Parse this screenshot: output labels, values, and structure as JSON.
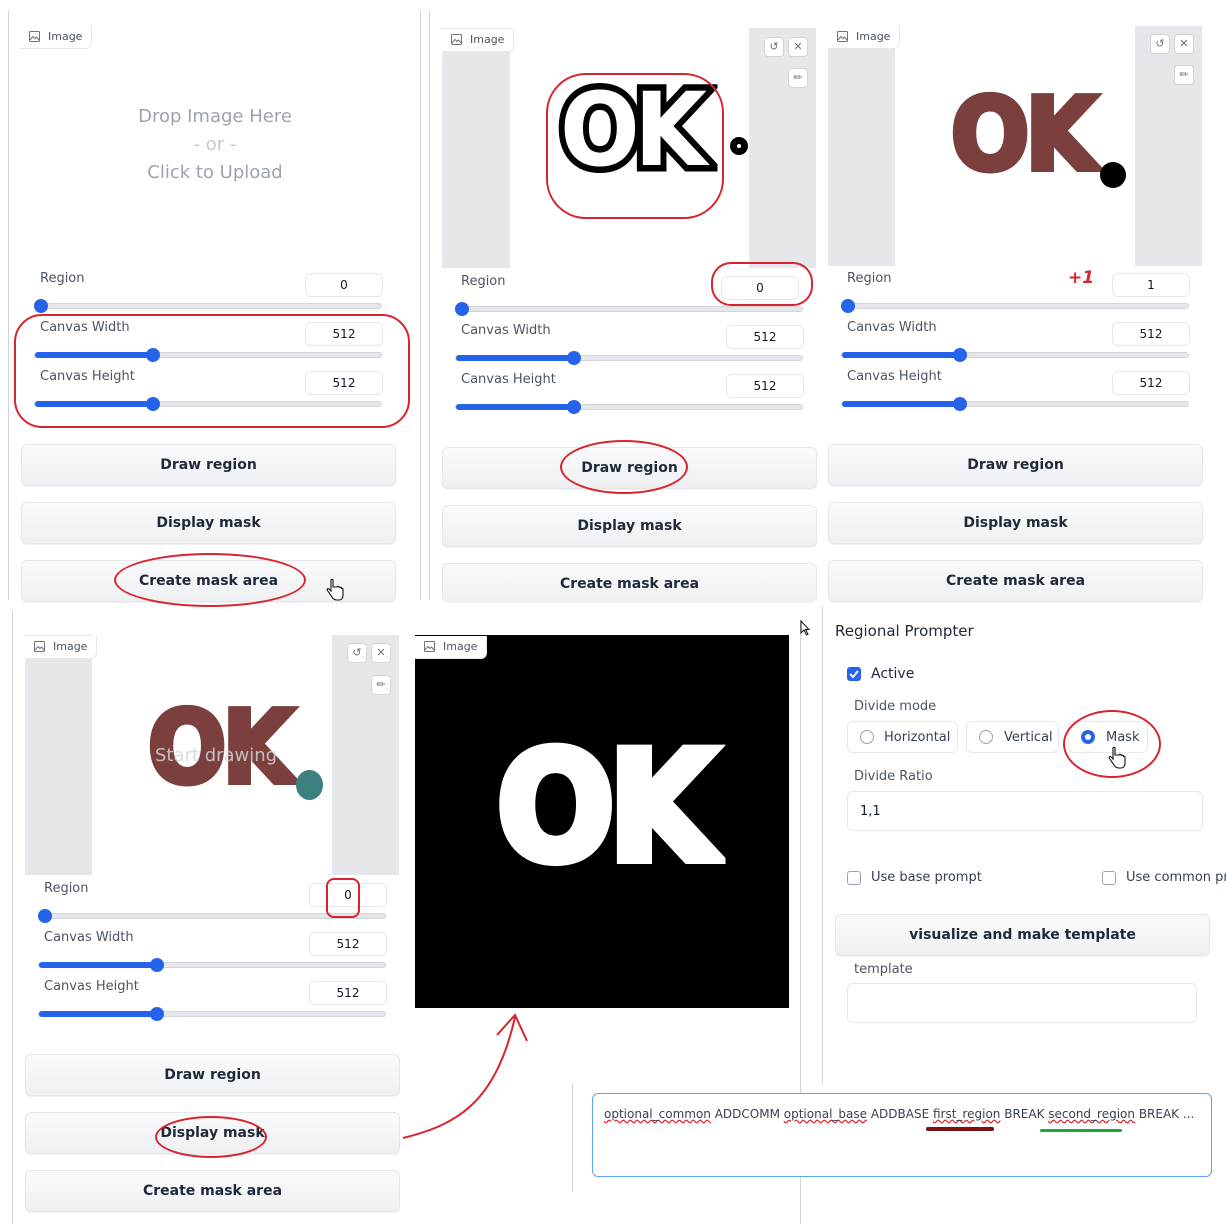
{
  "image_label": "Image",
  "upload": {
    "line1": "Drop Image Here",
    "line2": "- or -",
    "line3": "Click to Upload"
  },
  "labels": {
    "region": "Region",
    "canvas_width": "Canvas Width",
    "canvas_height": "Canvas Height"
  },
  "buttons": {
    "draw_region": "Draw region",
    "display_mask": "Display mask",
    "create_mask_area": "Create mask area"
  },
  "panels": [
    {
      "region": "0",
      "canvas_width": "512",
      "canvas_height": "512",
      "region_level": 0.0,
      "width_level": 0.34,
      "height_level": 0.34
    },
    {
      "region": "0",
      "canvas_width": "512",
      "canvas_height": "512",
      "region_level": 0.0,
      "width_level": 0.34,
      "height_level": 0.34
    },
    {
      "region": "1",
      "canvas_width": "512",
      "canvas_height": "512",
      "region_level": 0.0,
      "width_level": 0.34,
      "height_level": 0.34
    },
    {
      "region": "0",
      "canvas_width": "512",
      "canvas_height": "512",
      "region_level": 0.0,
      "width_level": 0.34,
      "height_level": 0.34
    }
  ],
  "canvas": {
    "placeholder": "Start drawing",
    "ok_text": "OK",
    "dot_text": "."
  },
  "annotation": {
    "plus_one": "+1"
  },
  "regional_prompter": {
    "title": "Regional Prompter",
    "active_label": "Active",
    "active_checked": true,
    "divide_mode_label": "Divide mode",
    "divide_modes": [
      "Horizontal",
      "Vertical",
      "Mask"
    ],
    "divide_mode_selected": "Mask",
    "divide_ratio_label": "Divide Ratio",
    "divide_ratio_value": "1,1",
    "use_base_prompt": "Use base prompt",
    "use_common_prompt": "Use common pro",
    "visualize_button": "visualize and make template",
    "template_label": "template",
    "template_value": ""
  },
  "prompt": {
    "parts": [
      "optional_common",
      " ADDCOMM ",
      "optional_base",
      " ADDBASE ",
      "first_region",
      " BREAK ",
      "second_region",
      " BREAK ..."
    ]
  },
  "colors": {
    "accent": "#2563eb",
    "annotation_red": "#d9232d",
    "brown": "#7b3f3d",
    "teal": "#3d8080",
    "underline_green": "#1fa53a",
    "underline_darkred": "#7a1010"
  }
}
